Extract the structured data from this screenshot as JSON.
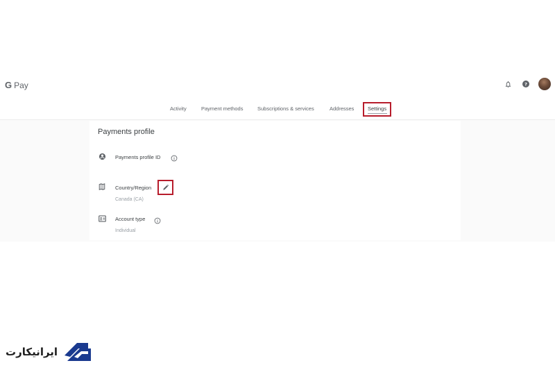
{
  "app": {
    "logo_letter": "G",
    "logo_text": "Pay"
  },
  "header": {
    "icons": [
      "bell-icon",
      "help-icon",
      "avatar"
    ]
  },
  "tabs": [
    {
      "label": "Activity",
      "active": false
    },
    {
      "label": "Payment methods",
      "active": false
    },
    {
      "label": "Subscriptions & services",
      "active": false
    },
    {
      "label": "Addresses",
      "active": false
    },
    {
      "label": "Settings",
      "active": true
    }
  ],
  "profile": {
    "title": "Payments profile",
    "rows": [
      {
        "label": "Payments profile ID",
        "value": "",
        "icon": "account-circle-icon"
      },
      {
        "label": "Country/Region",
        "value": "Canada (CA)",
        "icon": "map-icon"
      },
      {
        "label": "Account type",
        "value": "Individual",
        "icon": "id-card-icon"
      }
    ]
  },
  "watermark": {
    "text": "ایرانیکارت"
  },
  "colors": {
    "highlight": "#b71c2b",
    "brand_blue": "#1a3a8f"
  }
}
